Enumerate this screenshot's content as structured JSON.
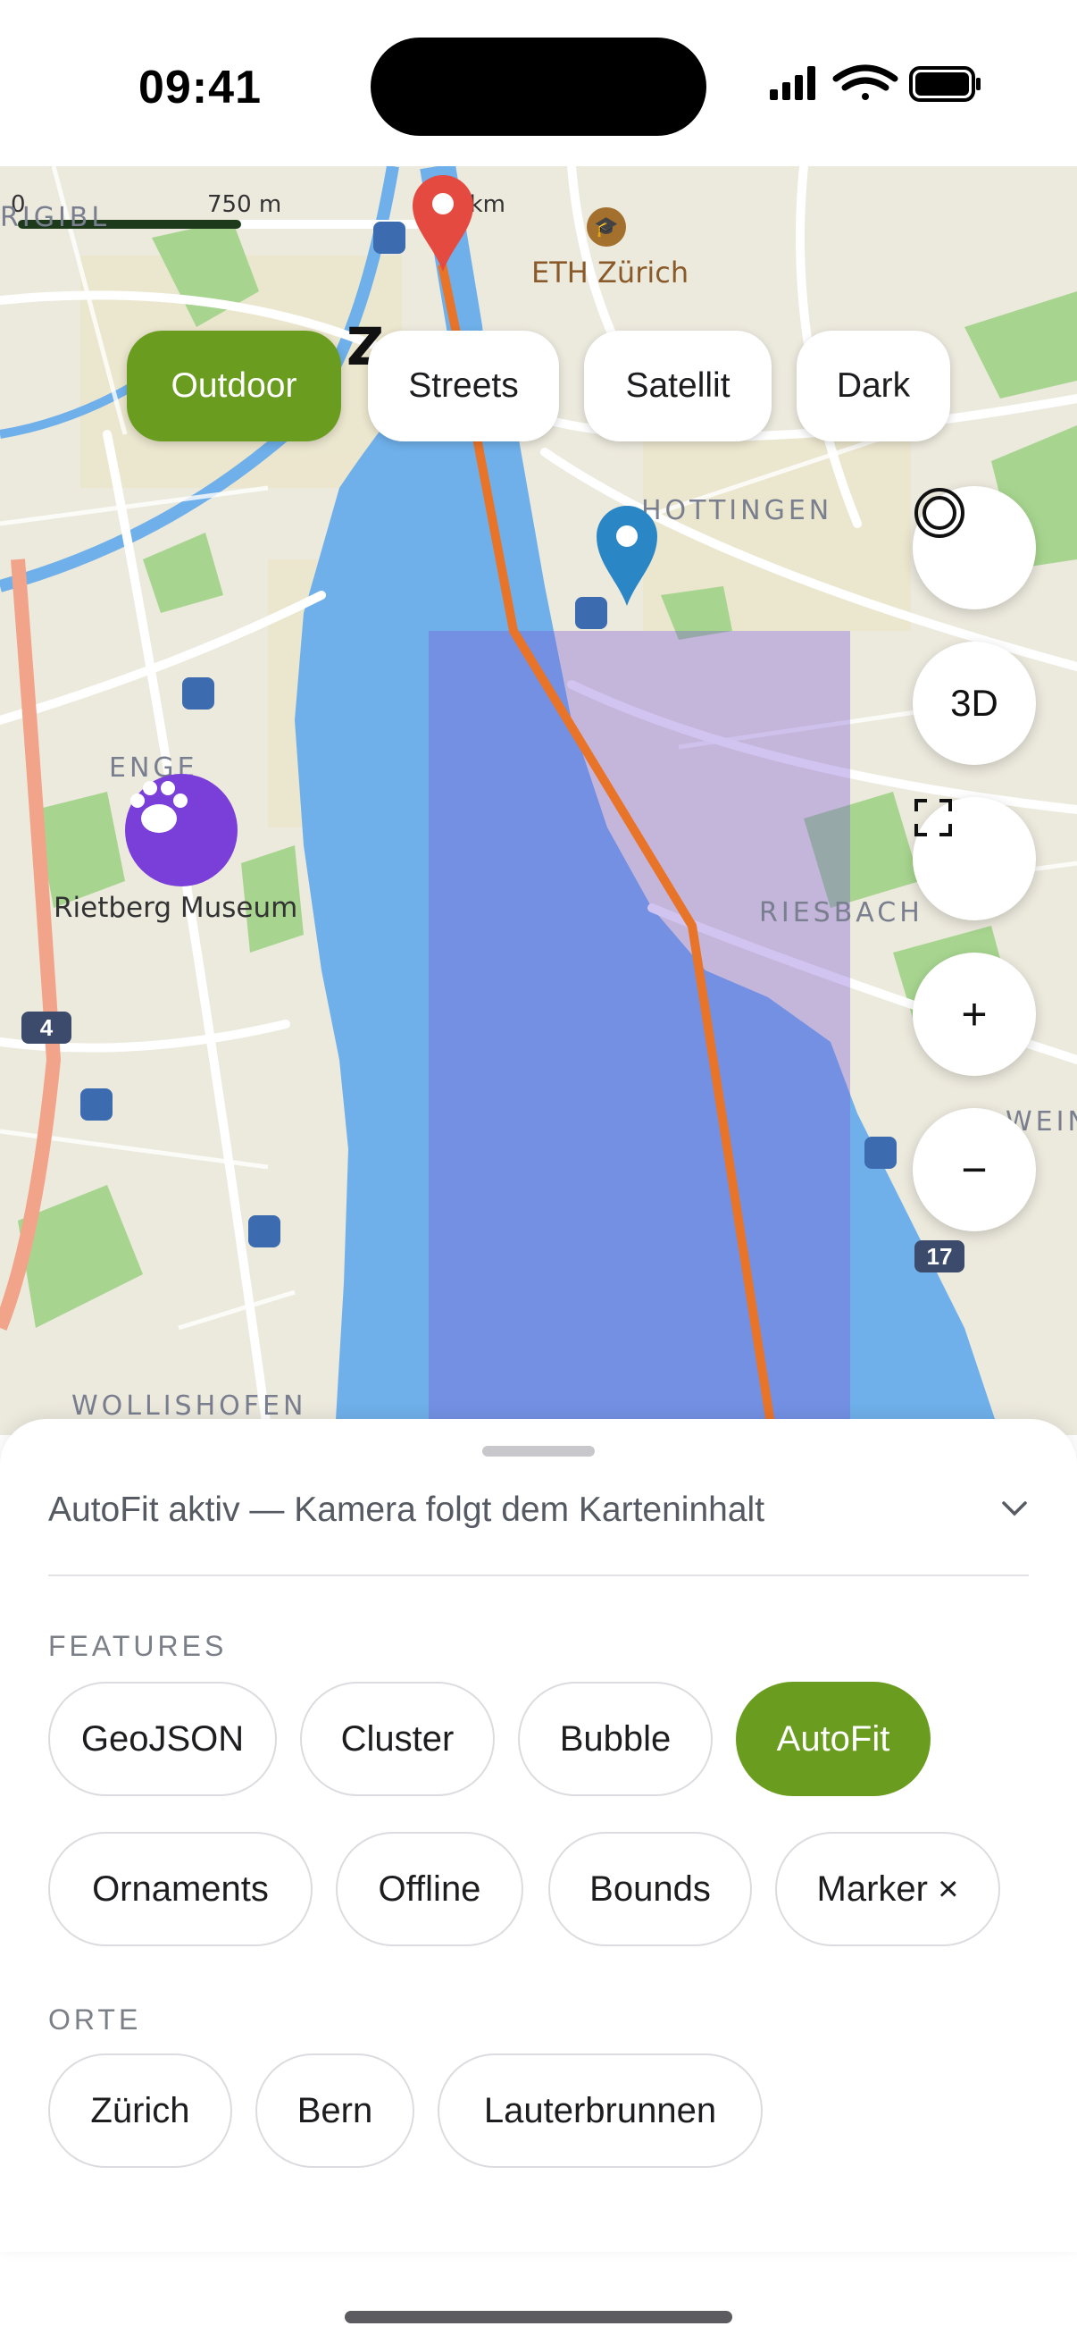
{
  "status_bar": {
    "time": "09:41"
  },
  "map": {
    "scale_labels": [
      "0",
      "750 m",
      "1.5 km"
    ],
    "place_labels": {
      "hottingen": "HOTTINGEN",
      "enge": "ENGE",
      "riesbach": "RIESBACH",
      "wollishofen": "WOLLISHOFEN",
      "eth": "ETH Zürich",
      "rietberg": "Rietberg Museum",
      "rigiblick": "RIGIBL",
      "weinegg": "WEIN",
      "z": "Z"
    },
    "road_badges": [
      "4",
      "17"
    ],
    "style_chips": [
      {
        "label": "Outdoor",
        "active": true
      },
      {
        "label": "Streets",
        "active": false
      },
      {
        "label": "Satellit",
        "active": false
      },
      {
        "label": "Dark",
        "active": false
      }
    ],
    "controls": {
      "three_d": "3D",
      "zoom_in": "+",
      "zoom_out": "−"
    },
    "colors": {
      "water": "#6fb0ea",
      "route": "#e8742a",
      "polygon": "#b98fd6",
      "active": "#6a9d1f",
      "paw_marker": "#7b3fd9",
      "pin_blue": "#2b86c5",
      "pin_red": "#e44a3f"
    }
  },
  "sheet": {
    "status": "AutoFit aktiv — Kamera folgt dem Karteninhalt",
    "features_title": "FEATURES",
    "features": [
      {
        "label": "GeoJSON",
        "active": false
      },
      {
        "label": "Cluster",
        "active": false
      },
      {
        "label": "Bubble",
        "active": false
      },
      {
        "label": "AutoFit",
        "active": true
      },
      {
        "label": "Ornaments",
        "active": false
      },
      {
        "label": "Offline",
        "active": false
      },
      {
        "label": "Bounds",
        "active": false
      },
      {
        "label": "Marker ×",
        "active": false
      }
    ],
    "places_title": "ORTE",
    "places": [
      {
        "label": "Zürich"
      },
      {
        "label": "Bern"
      },
      {
        "label": "Lauterbrunnen"
      }
    ]
  }
}
